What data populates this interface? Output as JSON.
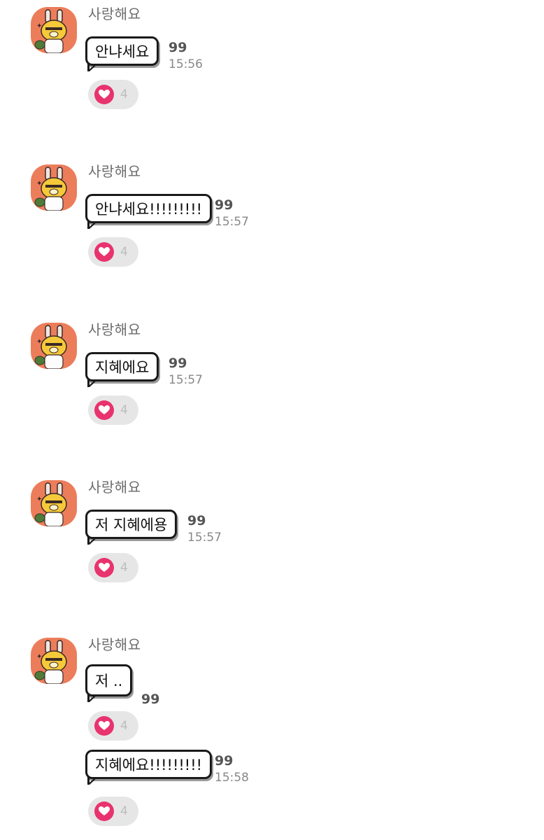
{
  "colors": {
    "avatar_bg": "#ec7d5b",
    "like_heart": "#e8336f",
    "like_bg": "#e6e6e6"
  },
  "icons": {
    "avatar": "ryan-bunny-character-icon",
    "like": "heart-icon"
  },
  "messages": [
    {
      "sender": "사랑해요",
      "text": "안냐세요",
      "count": "99",
      "time": "15:56",
      "likes": "4"
    },
    {
      "sender": "사랑해요",
      "text": "안냐세요!!!!!!!!!",
      "count": "99",
      "time": "15:57",
      "likes": "4"
    },
    {
      "sender": "사랑해요",
      "text": "지혜에요",
      "count": "99",
      "time": "15:57",
      "likes": "4"
    },
    {
      "sender": "사랑해요",
      "text": "저 지혜에용",
      "count": "99",
      "time": "15:57",
      "likes": "4"
    },
    {
      "sender": "사랑해요",
      "text": "저 ..",
      "count": "99",
      "likes": "4"
    },
    {
      "text": "지혜에요!!!!!!!!!",
      "count": "99",
      "time": "15:58",
      "likes": "4"
    }
  ]
}
